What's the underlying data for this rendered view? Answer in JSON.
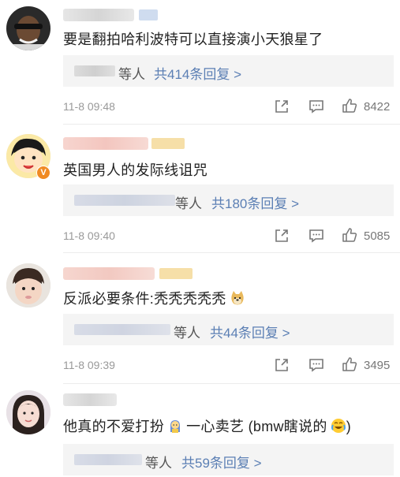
{
  "comments": [
    {
      "text": "要是翻拍哈利波特可以直接演小天狼星了",
      "replies_who": "等人",
      "replies_link": "共414条回复 >",
      "time": "11-8 09:48",
      "likes": "8422"
    },
    {
      "text": "英国男人的发际线诅咒",
      "replies_who": "等人",
      "replies_link": "共180条回复 >",
      "time": "11-8 09:40",
      "likes": "5085",
      "badge": "V"
    },
    {
      "text": "反派必要条件:秃秃秃秃秃",
      "replies_who": "等人",
      "replies_link": "共44条回复 >",
      "time": "11-8 09:39",
      "likes": "3495"
    },
    {
      "text_a": "他真的不爱打扮",
      "text_b": "一心卖艺 (bmw瞎说的",
      "text_c": ")",
      "replies_who": "等人",
      "replies_link": "共59条回复 >"
    }
  ],
  "colors": {
    "link": "#5b7fb4",
    "badge": "#f08a23",
    "muted": "#999999"
  },
  "icons": [
    "share-icon",
    "comment-icon",
    "like-icon",
    "doge-emoji",
    "sweat-emoji",
    "laugh-cry-emoji"
  ]
}
